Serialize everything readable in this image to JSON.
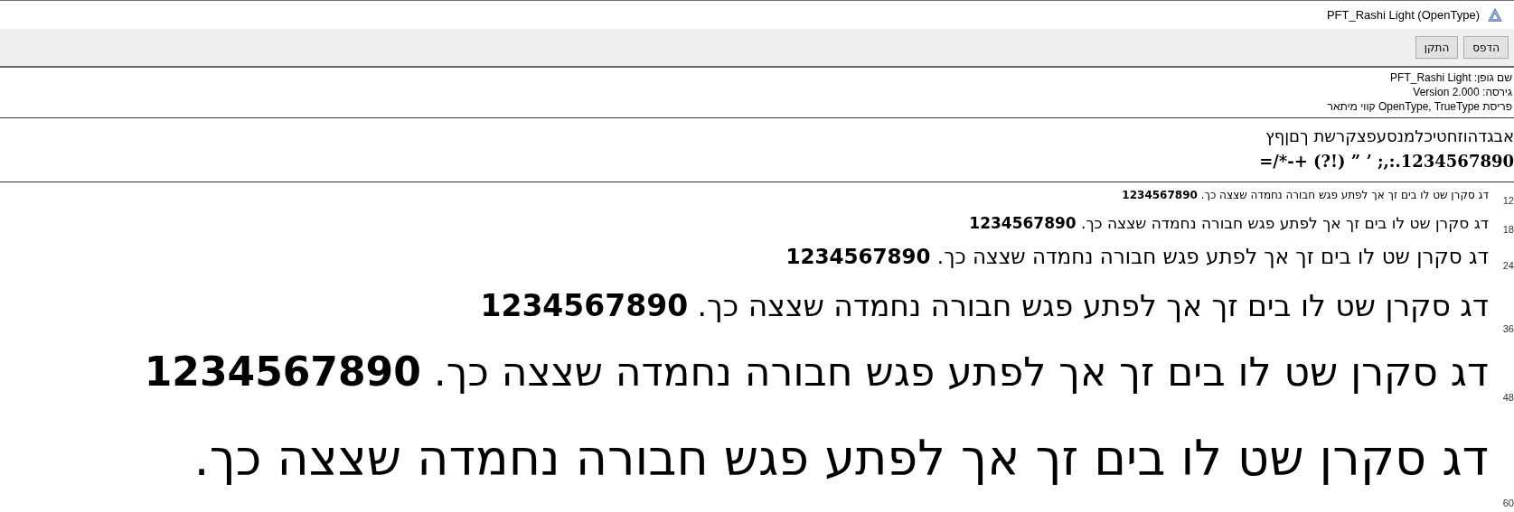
{
  "window": {
    "title": "PFT_Rashi Light (OpenType)"
  },
  "toolbar": {
    "buttons": [
      {
        "label": "הדפס"
      },
      {
        "label": "התקן"
      }
    ]
  },
  "info": [
    "שם גופן: PFT_Rashi Light",
    "גירסה: Version 2.000",
    "פריסת OpenType, TrueType קווי מיתאר"
  ],
  "charset": [
    "אבגדהוזחטיכלמנסעפצקרשת ךםןףץ",
    "1234567890.:,; ’ ” (!?) +-*/="
  ],
  "samples": [
    {
      "size": "12",
      "text": "דג סקרן שט לו בים זך אך לפתע פגש חבורה נחמדה שצצה כך. **1234567890**"
    },
    {
      "size": "18",
      "text": "דג סקרן שט לו בים זך אך לפתע פגש חבורה נחמדה שצצה כך. **1234567890**"
    },
    {
      "size": "24",
      "text": "דג סקרן שט לו בים זך אך לפתע פגש חבורה נחמדה שצצה כך. **1234567890**"
    },
    {
      "size": "36",
      "text": "דג סקרן שט לו בים זך אך לפתע פגש חבורה נחמדה שצצה כך. **1234567890**"
    },
    {
      "size": "48",
      "text": "דג סקרן שט לו בים זך אך לפתע פגש חבורה נחמדה שצצה כך. **1234567890**"
    },
    {
      "size": "60",
      "text": "דג סקרן שט לו בים זך אך לפתע פגש חבורה נחמדה שצצה כך."
    }
  ]
}
